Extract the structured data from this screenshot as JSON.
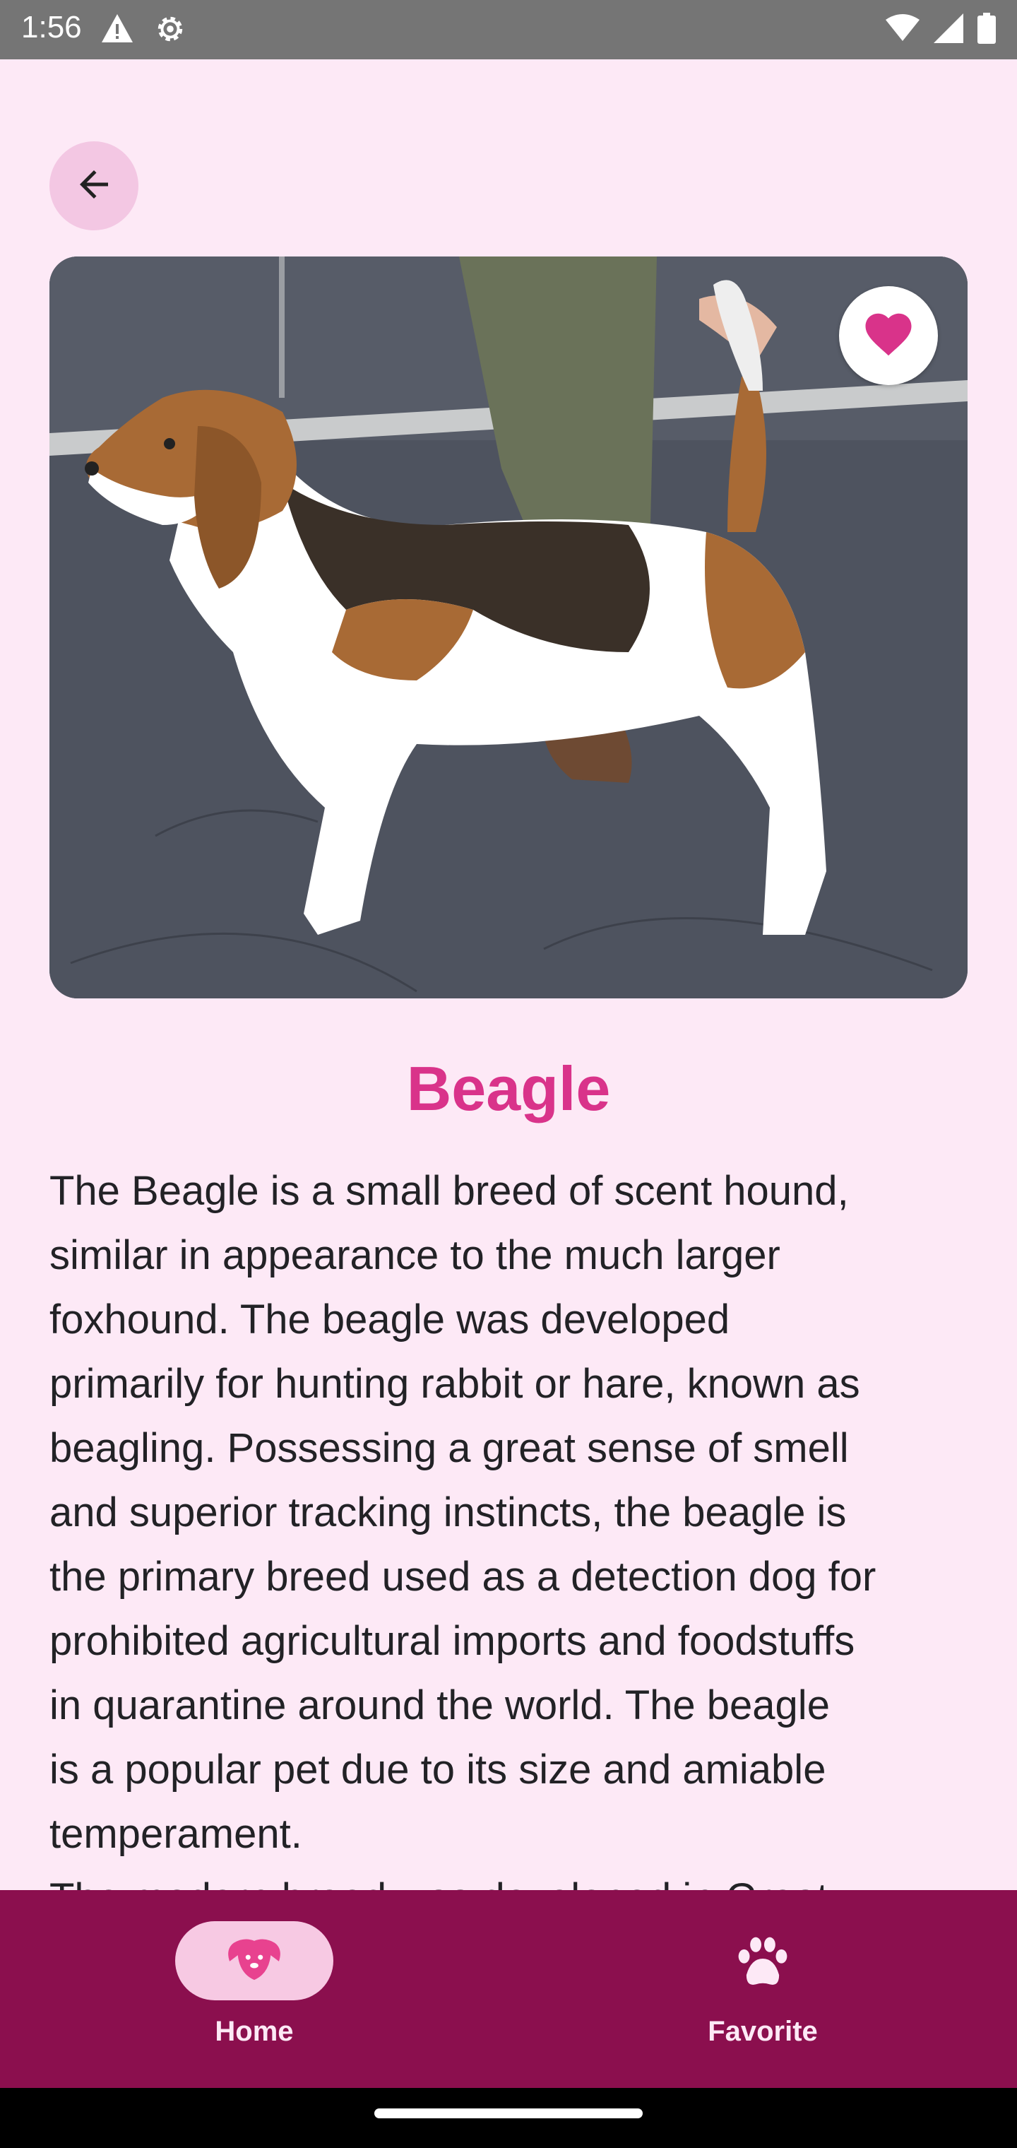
{
  "status_bar": {
    "time": "1:56",
    "icons": [
      "warning-icon",
      "settings-icon",
      "wifi-icon",
      "signal-icon",
      "battery-icon"
    ]
  },
  "header": {
    "back_icon": "arrow-back-icon"
  },
  "hero": {
    "image_subject": "beagle-photo",
    "favorite_icon": "heart-icon",
    "favorite_active": true
  },
  "breed": {
    "name": "Beagle",
    "description": "The Beagle is a small breed of scent hound,\nsimilar in appearance to the much larger\nfoxhound. The beagle was developed\nprimarily for hunting rabbit or hare, known as\nbeagling. Possessing a great sense of smell\nand superior tracking instincts, the beagle is\nthe primary breed used as a detection dog for\nprohibited agricultural imports and foodstuffs\nin quarantine around the world. The beagle\nis a popular pet due to its size and amiable\ntemperament.\nThe modern breed was developed in Great"
  },
  "bottom_nav": {
    "items": [
      {
        "label": "Home",
        "icon": "dog-face-icon",
        "selected": true
      },
      {
        "label": "Favorite",
        "icon": "paw-icon",
        "selected": false
      }
    ]
  },
  "colors": {
    "background": "#fde9f6",
    "accent": "#d9338a",
    "nav_background": "#8b0f4e",
    "nav_indicator": "#f7c9e3",
    "back_button": "#f3c7e3"
  }
}
